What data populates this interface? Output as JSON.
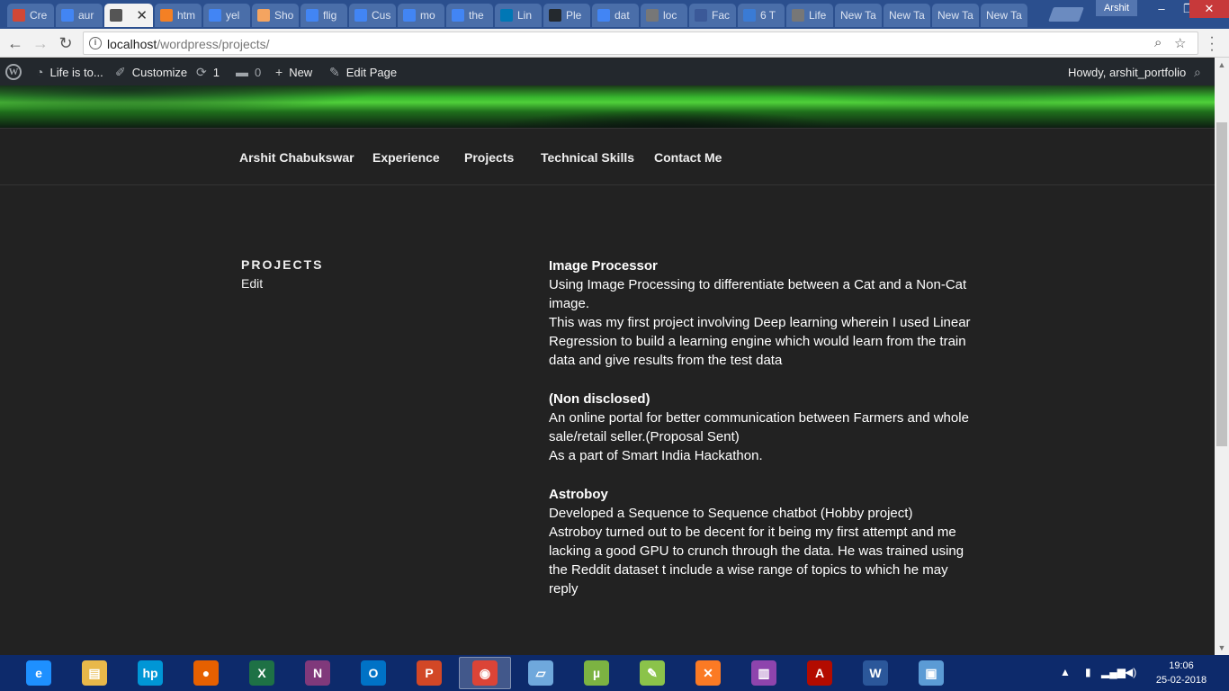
{
  "browser": {
    "tabs": [
      {
        "label": "Cre",
        "icon": "chrome-icon",
        "color": "#d14836"
      },
      {
        "label": "aur",
        "icon": "google-icon",
        "color": "#4285f4"
      },
      {
        "label": "",
        "icon": "page-icon",
        "color": "#555555",
        "active": true
      },
      {
        "label": "htm",
        "icon": "stackoverflow-icon",
        "color": "#f48024"
      },
      {
        "label": "yel",
        "icon": "google-icon",
        "color": "#4285f4"
      },
      {
        "label": "Sho",
        "icon": "star-icon",
        "color": "#f4a460"
      },
      {
        "label": "flig",
        "icon": "google-icon",
        "color": "#4285f4"
      },
      {
        "label": "Cus",
        "icon": "google-icon",
        "color": "#4285f4"
      },
      {
        "label": "mo",
        "icon": "google-icon",
        "color": "#4285f4"
      },
      {
        "label": "the",
        "icon": "google-icon",
        "color": "#4285f4"
      },
      {
        "label": "Lin",
        "icon": "linkedin-icon",
        "color": "#0077b5"
      },
      {
        "label": "Ple",
        "icon": "github-icon",
        "color": "#24292e"
      },
      {
        "label": "dat",
        "icon": "google-icon",
        "color": "#4285f4"
      },
      {
        "label": "loc",
        "icon": "page-icon",
        "color": "#777777"
      },
      {
        "label": "Fac",
        "icon": "facebook-icon",
        "color": "#3b5998"
      },
      {
        "label": "6 T",
        "icon": "medium-icon",
        "color": "#3a7bd5"
      },
      {
        "label": "Life",
        "icon": "page-icon",
        "color": "#777777"
      },
      {
        "label": "New Ta",
        "icon": "",
        "color": ""
      },
      {
        "label": "New Ta",
        "icon": "",
        "color": ""
      },
      {
        "label": "New Ta",
        "icon": "",
        "color": ""
      },
      {
        "label": "New Ta",
        "icon": "",
        "color": ""
      }
    ],
    "profile_name": "Arshit",
    "url_host": "localhost",
    "url_path": "/wordpress/projects/"
  },
  "adminbar": {
    "site_name": "Life is to...",
    "customize": "Customize",
    "updates_count": "1",
    "comments_count": "0",
    "new_label": "New",
    "edit_page": "Edit Page",
    "howdy": "Howdy, arshit_portfolio"
  },
  "nav": {
    "items": [
      "Arshit Chabukswar",
      "Experience",
      "Projects",
      "Technical Skills",
      "Contact Me"
    ]
  },
  "page": {
    "title": "PROJECTS",
    "edit": "Edit"
  },
  "projects": [
    {
      "title": "Image Processor",
      "lines": [
        "Using Image Processing to differentiate between a Cat and a Non-Cat image.",
        "This was my first project involving Deep learning wherein I used Linear Regression to build a learning engine which would learn from the train data and give results from the test data"
      ]
    },
    {
      "title": "(Non disclosed)",
      "lines": [
        "An online portal for better communication between Farmers and whole sale/retail seller.(Proposal Sent)",
        "As a part of Smart India Hackathon."
      ]
    },
    {
      "title": "Astroboy",
      "lines": [
        "Developed a Sequence to Sequence chatbot (Hobby project)",
        "Astroboy turned out to be decent for it being my first attempt and me lacking a good GPU to crunch through the data. He was trained using the Reddit dataset t include a wise range of topics to which he may reply"
      ]
    }
  ],
  "taskbar": {
    "apps": [
      {
        "name": "internet-explorer-icon",
        "glyph": "e",
        "color": "#1e90ff"
      },
      {
        "name": "file-explorer-icon",
        "glyph": "▤",
        "color": "#e8b84a"
      },
      {
        "name": "hp-icon",
        "glyph": "hp",
        "color": "#0096d6"
      },
      {
        "name": "firefox-icon",
        "glyph": "●",
        "color": "#e66000"
      },
      {
        "name": "excel-icon",
        "glyph": "X",
        "color": "#1e7145"
      },
      {
        "name": "onenote-icon",
        "glyph": "N",
        "color": "#80397b"
      },
      {
        "name": "outlook-icon",
        "glyph": "O",
        "color": "#0072c6"
      },
      {
        "name": "powerpoint-icon",
        "glyph": "P",
        "color": "#d24726"
      },
      {
        "name": "chrome-icon",
        "glyph": "◉",
        "color": "#db4437",
        "active": true
      },
      {
        "name": "notepad-icon",
        "glyph": "▱",
        "color": "#6fa8dc"
      },
      {
        "name": "utorrent-icon",
        "glyph": "µ",
        "color": "#7cb342"
      },
      {
        "name": "notepad-plus-icon",
        "glyph": "✎",
        "color": "#8bc34a"
      },
      {
        "name": "xampp-icon",
        "glyph": "✕",
        "color": "#fb7a24"
      },
      {
        "name": "winrar-icon",
        "glyph": "▥",
        "color": "#8e44ad"
      },
      {
        "name": "acrobat-icon",
        "glyph": "A",
        "color": "#b30b00"
      },
      {
        "name": "word-icon",
        "glyph": "W",
        "color": "#2b579a"
      },
      {
        "name": "virtualbox-icon",
        "glyph": "▣",
        "color": "#5b9bd5"
      }
    ],
    "time": "19:06",
    "date": "25-02-2018"
  }
}
